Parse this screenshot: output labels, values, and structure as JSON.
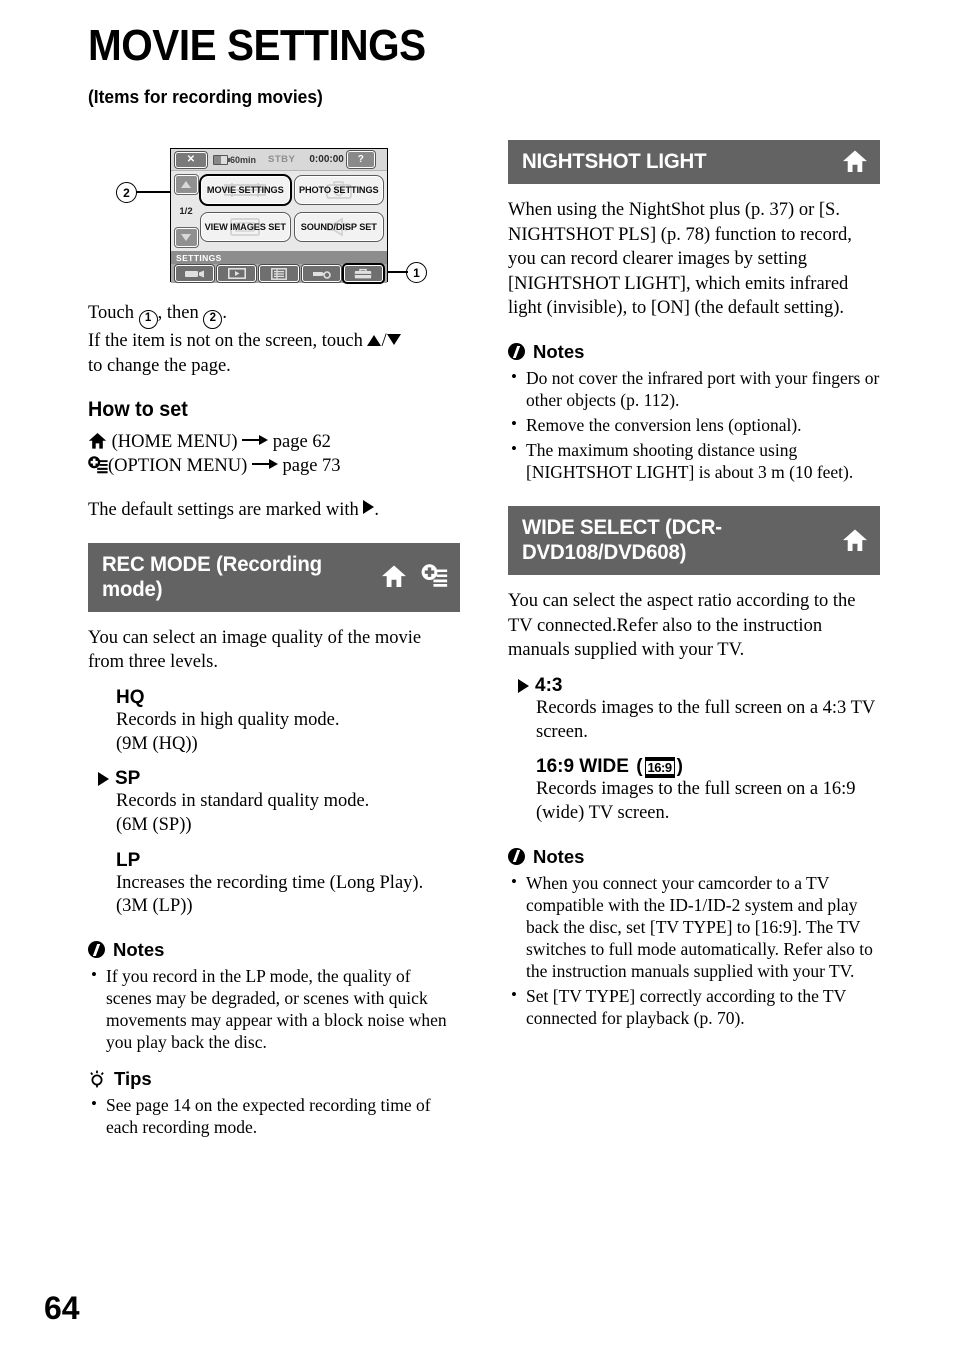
{
  "page": {
    "title": "MOVIE SETTINGS",
    "subtitle": "(Items for recording movies)",
    "number": "64"
  },
  "diagram": {
    "status_bar": {
      "close_label": "✕",
      "battery_label": "60min",
      "mode_label": "STBY",
      "timecode": "0:00:00",
      "help_label": "?"
    },
    "page_indicator": "1/2",
    "menu_buttons": [
      {
        "label": "MOVIE SETTINGS",
        "selected": true,
        "ghost_icon": "film-strip-icon"
      },
      {
        "label": "PHOTO SETTINGS",
        "selected": false,
        "ghost_icon": "camera-icon"
      },
      {
        "label": "VIEW IMAGES SET",
        "selected": false,
        "ghost_icon": "photo-frame-icon"
      },
      {
        "label": "SOUND/DISP SET",
        "selected": false,
        "ghost_icon": "speaker-icon"
      }
    ],
    "category_label": "SETTINGS",
    "tabs": [
      {
        "icon": "camcorder-icon",
        "selected": false
      },
      {
        "icon": "playback-icon",
        "selected": false
      },
      {
        "icon": "list-icon",
        "selected": false
      },
      {
        "icon": "others-icon",
        "selected": false
      },
      {
        "icon": "toolbox-settings-icon",
        "selected": true
      }
    ],
    "callouts": {
      "one": "1",
      "two": "2"
    }
  },
  "intro": {
    "line1_pre": "Touch ",
    "line1_mid": ", then ",
    "line1_end": ".",
    "circle1": "1",
    "circle2": "2",
    "line2_pre": "If the item is not on the screen, touch ",
    "line2_sep": "/",
    "line2_end": "",
    "line3": "to change the page."
  },
  "how_to_set": {
    "heading": "How to set",
    "home_text": "(HOME MENU)",
    "home_page": "page 62",
    "option_text": "(OPTION MENU)",
    "option_page": "page 73",
    "default_note_pre": "The default settings are marked with ",
    "default_note_end": "."
  },
  "sections": [
    {
      "id": "rec-mode",
      "title": "REC MODE (Recording mode)",
      "icons": [
        "home-icon",
        "option-icon"
      ],
      "intro": "You can select an image quality of the movie from three levels.",
      "options": [
        {
          "name": "HQ",
          "default": false,
          "desc": "Records in high quality mode.\n(9M (HQ))"
        },
        {
          "name": "SP",
          "default": true,
          "desc": "Records in standard quality mode.\n(6M (SP))"
        },
        {
          "name": "LP",
          "default": false,
          "desc": "Increases the recording time (Long Play).\n(3M (LP))"
        }
      ],
      "notes": {
        "heading": "Notes",
        "items": [
          "If you record in the LP mode, the quality of scenes may be degraded, or scenes with quick movements may appear with a block noise when you play back the disc."
        ]
      },
      "tips": {
        "heading": "Tips",
        "items": [
          "See page 14 on the expected recording time of each recording mode."
        ]
      }
    },
    {
      "id": "nightshot-light",
      "title": "NIGHTSHOT LIGHT",
      "icons": [
        "home-icon"
      ],
      "intro": "When using the NightShot plus (p. 37) or [S. NIGHTSHOT PLS] (p. 78) function to record, you can record clearer images by setting [NIGHTSHOT LIGHT], which emits infrared light (invisible), to [ON] (the default setting).",
      "notes": {
        "heading": "Notes",
        "items": [
          "Do not cover the infrared port with your fingers or other objects (p. 112).",
          "Remove the conversion lens (optional).",
          "The maximum shooting distance using [NIGHTSHOT LIGHT] is about 3 m (10 feet)."
        ]
      }
    },
    {
      "id": "wide-select",
      "title": "WIDE SELECT (DCR-DVD108/DVD608)",
      "icons": [
        "home-icon"
      ],
      "intro": "You can select the aspect ratio according to the TV connected.Refer also to the instruction manuals supplied with your TV.",
      "options": [
        {
          "name": "4:3",
          "default": true,
          "desc": "Records images to the full screen on a 4:3 TV screen."
        },
        {
          "name": "16:9 WIDE",
          "badge": "16:9",
          "default": false,
          "desc": "Records images to the full screen on a 16:9 (wide) TV screen."
        }
      ],
      "notes": {
        "heading": "Notes",
        "items": [
          "When you connect your camcorder to a TV compatible with the ID-1/ID-2 system and play back the disc, set [TV TYPE] to [16:9]. The TV switches to full mode automatically. Refer also to the instruction manuals supplied with your TV.",
          "Set [TV TYPE] correctly according to the TV connected for playback (p. 70)."
        ]
      }
    }
  ],
  "colors": {
    "section_header_bg": "#636363",
    "lcd_bg": "#e8e8e8",
    "lcd_tabbar": "#a8a8a8"
  }
}
